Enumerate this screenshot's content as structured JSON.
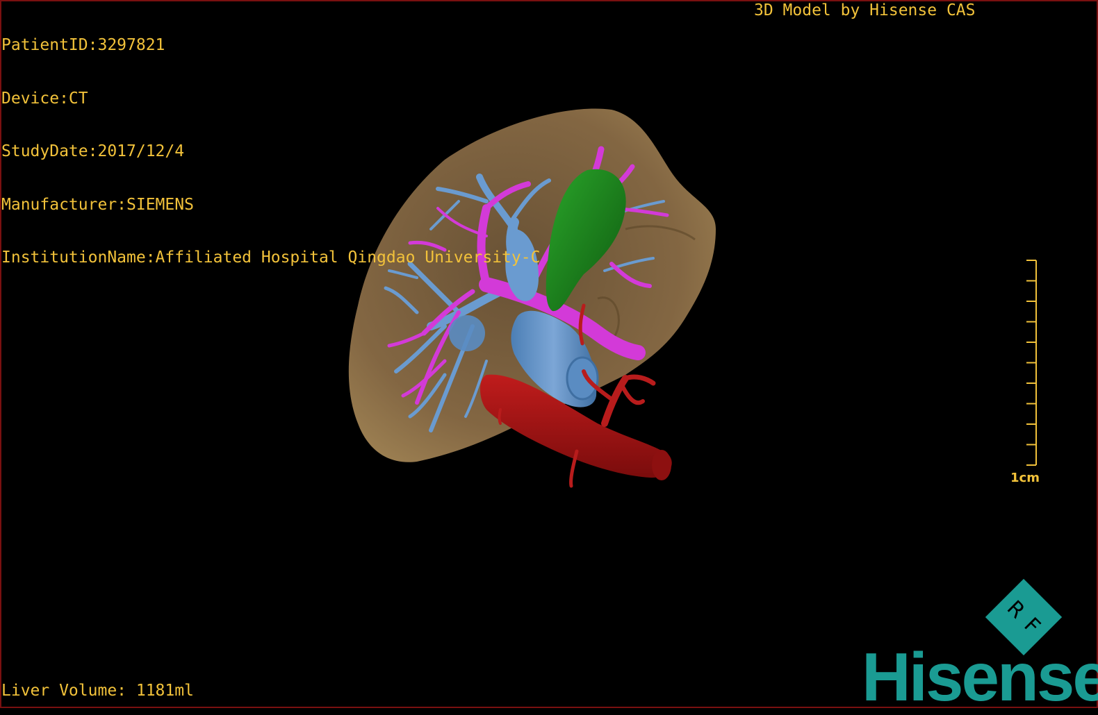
{
  "overlay": {
    "patient_id": "PatientID:3297821",
    "device": "Device:CT",
    "study_date": "StudyDate:2017/12/4",
    "manufacturer": "Manufacturer:SIEMENS",
    "institution": "InstitutionName:Affiliated Hospital Qingdao University-C",
    "credit": "3D Model by Hisense CAS",
    "liver_volume": "Liver Volume: 1181ml"
  },
  "scale_bar": {
    "label": "1cm",
    "ticks": 10
  },
  "logo": {
    "badge_letters": [
      "R",
      "F"
    ],
    "brand": "Hisense",
    "color": "#1a9b93"
  },
  "colors": {
    "text": "#f2c23a",
    "liver": "#8a6c46",
    "portal_vein": "#6a9bd0",
    "hepatic_vein": "#d33ad8",
    "artery": "#a51414",
    "gallbladder": "#1f8a1f"
  }
}
